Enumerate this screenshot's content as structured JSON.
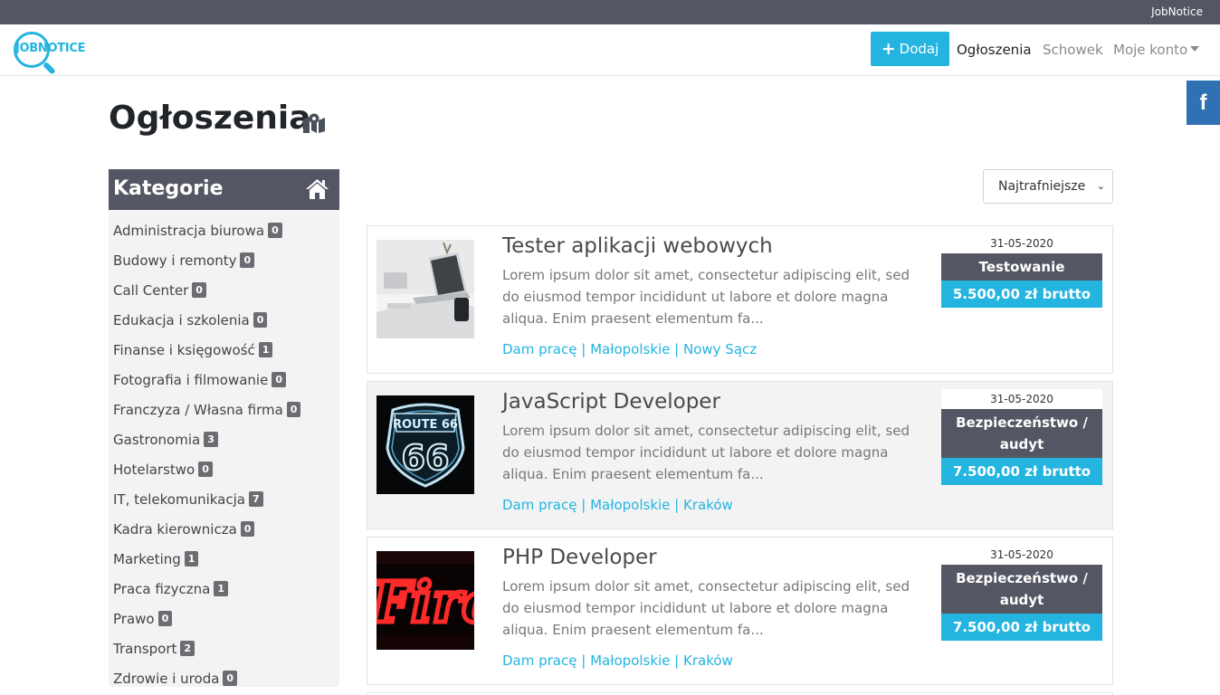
{
  "topbar": {
    "brand": "JobNotice"
  },
  "logo": {
    "text": "JOBNOTICE"
  },
  "nav": {
    "add_label": "Dodaj",
    "ogloszenia": "Ogłoszenia",
    "schowek": "Schowek",
    "account": "Moje konto"
  },
  "social": {
    "facebook": "f"
  },
  "page": {
    "title": "Ogłoszenia"
  },
  "sidebar": {
    "title": "Kategorie",
    "categories": [
      {
        "label": "Administracja biurowa",
        "count": "0"
      },
      {
        "label": "Budowy i remonty",
        "count": "0"
      },
      {
        "label": "Call Center",
        "count": "0"
      },
      {
        "label": "Edukacja i szkolenia",
        "count": "0"
      },
      {
        "label": "Finanse i księgowość",
        "count": "1"
      },
      {
        "label": "Fotografia i filmowanie",
        "count": "0"
      },
      {
        "label": "Franczyza / Własna firma",
        "count": "0"
      },
      {
        "label": "Gastronomia",
        "count": "3"
      },
      {
        "label": "Hotelarstwo",
        "count": "0"
      },
      {
        "label": "IT, telekomunikacja",
        "count": "7"
      },
      {
        "label": "Kadra kierownicza",
        "count": "0"
      },
      {
        "label": "Marketing",
        "count": "1"
      },
      {
        "label": "Praca fizyczna",
        "count": "1"
      },
      {
        "label": "Prawo",
        "count": "0"
      },
      {
        "label": "Transport",
        "count": "2"
      },
      {
        "label": "Zdrowie i uroda",
        "count": "0"
      }
    ]
  },
  "sort": {
    "selected": "Najtrafniejsze"
  },
  "offers": [
    {
      "title": "Tester aplikacji webowych",
      "description": "Lorem ipsum dolor sit amet, consectetur adipiscing elit, sed do eiusmod tempor incididunt ut labore et dolore magna aliqua. Enim praesent elementum fa...",
      "location": "Dam pracę | Małopolskie | Nowy Sącz",
      "date": "31-05-2020",
      "category": "Testowanie",
      "salary": "5.500,00 zł brutto"
    },
    {
      "title": "JavaScript Developer",
      "description": "Lorem ipsum dolor sit amet, consectetur adipiscing elit, sed do eiusmod tempor incididunt ut labore et dolore magna aliqua. Enim praesent elementum fa...",
      "location": "Dam pracę | Małopolskie | Kraków",
      "date": "31-05-2020",
      "category": "Bezpieczeństwo / audyt",
      "salary": "7.500,00 zł brutto",
      "thumb_text": "ROUTE 66"
    },
    {
      "title": "PHP Developer",
      "description": "Lorem ipsum dolor sit amet, consectetur adipiscing elit, sed do eiusmod tempor incididunt ut labore et dolore magna aliqua. Enim praesent elementum fa...",
      "location": "Dam pracę | Małopolskie | Kraków",
      "date": "31-05-2020",
      "category": "Bezpieczeństwo / audyt",
      "salary": "7.500,00 zł brutto",
      "thumb_text": "Fire"
    }
  ],
  "colors": {
    "accent": "#23b4e0",
    "dark": "#545763",
    "facebook": "#2f71b3"
  }
}
